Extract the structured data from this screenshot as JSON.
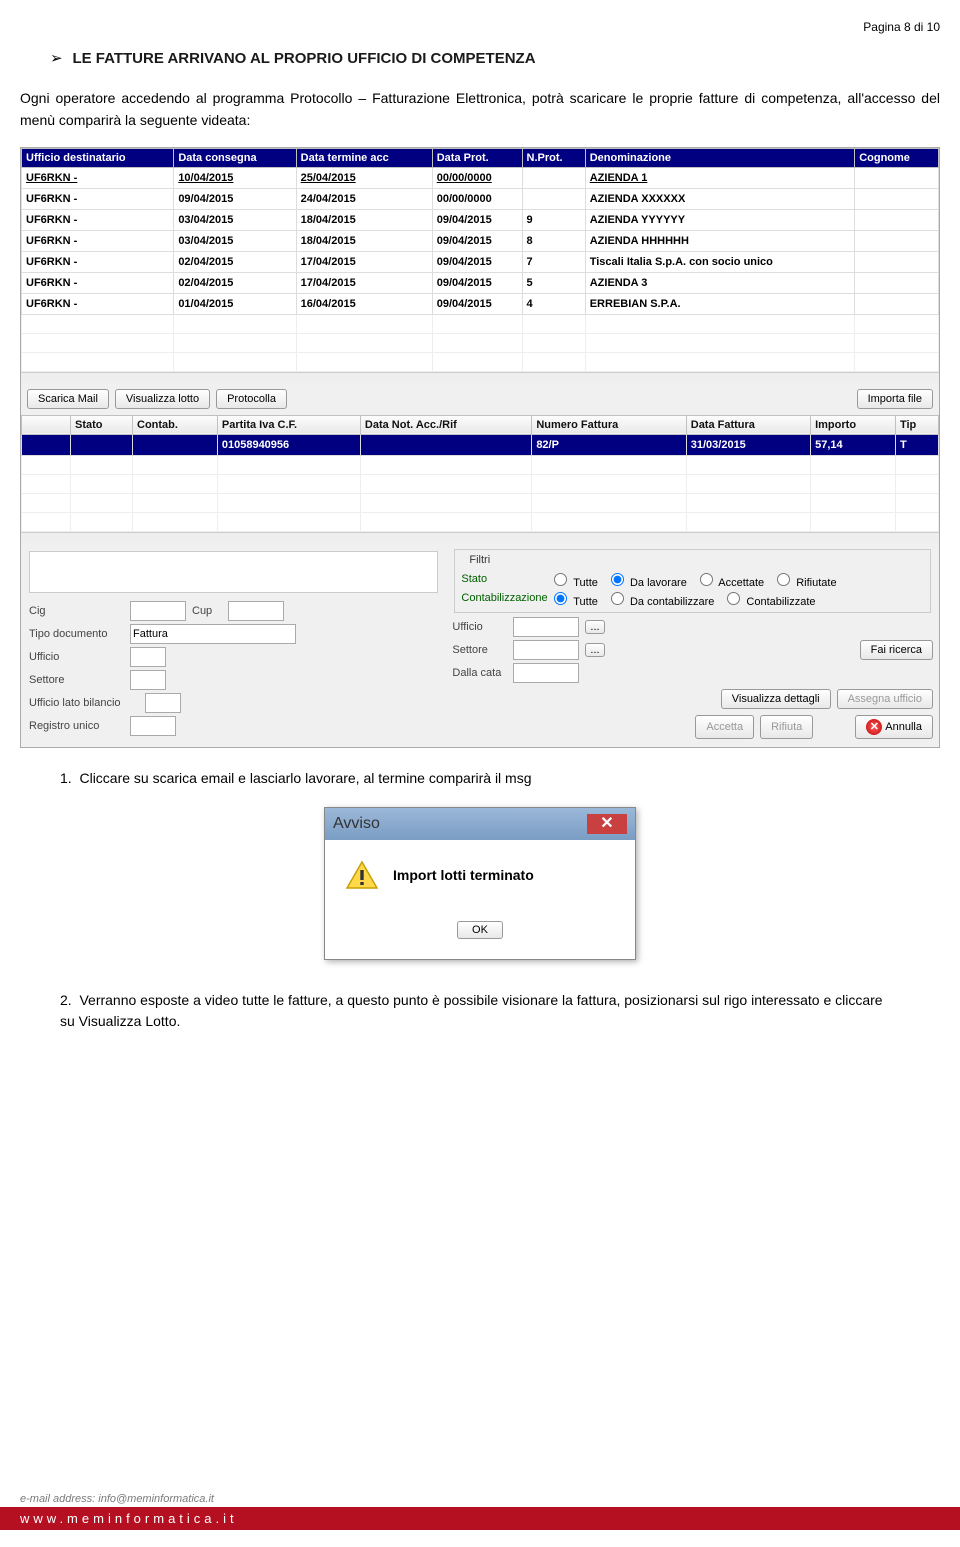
{
  "page_number": "Pagina 8 di 10",
  "section_title": "LE FATTURE ARRIVANO AL PROPRIO UFFICIO DI COMPETENZA",
  "intro_text": "Ogni operatore accedendo al programma Protocollo – Fatturazione Elettronica, potrà scaricare le proprie fatture di competenza, all'accesso del menù comparirà la seguente videata:",
  "table1": {
    "headers": [
      "Ufficio destinatario",
      "Data consegna",
      "Data termine acc",
      "Data Prot.",
      "N.Prot.",
      "Denominazione",
      "Cognome"
    ],
    "rows": [
      {
        "ufficio": "UF6RKN -",
        "consegna": "10/04/2015",
        "termine": "25/04/2015",
        "prot": "00/00/0000",
        "nprot": "",
        "denom": "AZIENDA 1",
        "cog": "",
        "sel": true
      },
      {
        "ufficio": "UF6RKN -",
        "consegna": "09/04/2015",
        "termine": "24/04/2015",
        "prot": "00/00/0000",
        "nprot": "",
        "denom": "AZIENDA XXXXXX",
        "cog": ""
      },
      {
        "ufficio": "UF6RKN -",
        "consegna": "03/04/2015",
        "termine": "18/04/2015",
        "prot": "09/04/2015",
        "nprot": "9",
        "denom": "AZIENDA YYYYYY",
        "cog": ""
      },
      {
        "ufficio": "UF6RKN -",
        "consegna": "03/04/2015",
        "termine": "18/04/2015",
        "prot": "09/04/2015",
        "nprot": "8",
        "denom": "AZIENDA HHHHHH",
        "cog": ""
      },
      {
        "ufficio": "UF6RKN -",
        "consegna": "02/04/2015",
        "termine": "17/04/2015",
        "prot": "09/04/2015",
        "nprot": "7",
        "denom": "Tiscali Italia S.p.A. con socio unico",
        "cog": ""
      },
      {
        "ufficio": "UF6RKN -",
        "consegna": "02/04/2015",
        "termine": "17/04/2015",
        "prot": "09/04/2015",
        "nprot": "5",
        "denom": "AZIENDA 3",
        "cog": ""
      },
      {
        "ufficio": "UF6RKN -",
        "consegna": "01/04/2015",
        "termine": "16/04/2015",
        "prot": "09/04/2015",
        "nprot": "4",
        "denom": "ERREBIAN S.P.A.",
        "cog": ""
      }
    ]
  },
  "buttons1": {
    "scarica": "Scarica Mail",
    "visualizza": "Visualizza lotto",
    "protocolla": "Protocolla",
    "importa": "Importa file"
  },
  "table2": {
    "headers": [
      "",
      "Stato",
      "Contab.",
      "Partita Iva C.F.",
      "Data Not. Acc./Rif",
      "Numero Fattura",
      "Data Fattura",
      "Importo",
      "Tip"
    ],
    "row": {
      "piva": "01058940956",
      "num": "82/P",
      "data": "31/03/2015",
      "imp": "57,14",
      "tip": "T"
    }
  },
  "left_fields": {
    "cig": "Cig",
    "cup": "Cup",
    "tipo_doc_label": "Tipo documento",
    "tipo_doc_value": "Fattura",
    "ufficio": "Ufficio",
    "settore": "Settore",
    "ufficio_lato": "Ufficio lato bilancio",
    "registro": "Registro unico"
  },
  "filtri": {
    "title": "Filtri",
    "stato": "Stato",
    "tutte": "Tutte",
    "dalav": "Da lavorare",
    "accett": "Accettate",
    "rifiut": "Rifiutate",
    "contab": "Contabilizzazione",
    "dacontab": "Da contabilizzare",
    "contabz": "Contabilizzate",
    "ufficio": "Ufficio",
    "settore": "Settore",
    "dalla": "Dalla cata",
    "fairicerca": "Fai ricerca",
    "visdet": "Visualizza dettagli",
    "assegna": "Assegna ufficio",
    "accetta": "Accetta",
    "rifiuta": "Rifiuta",
    "annulla": "Annulla"
  },
  "step1": "Cliccare su scarica email e lasciarlo lavorare, al termine comparirà il msg",
  "avviso": {
    "title": "Avviso",
    "msg": "Import lotti terminato",
    "ok": "OK"
  },
  "step2": "Verranno esposte a video tutte le fatture, a questo punto è possibile visionare la fattura, posizionarsi sul rigo interessato e cliccare su Visualizza Lotto.",
  "footer_email": "e-mail address: info@meminformatica.it",
  "footer_url": "www.meminformatica.it"
}
